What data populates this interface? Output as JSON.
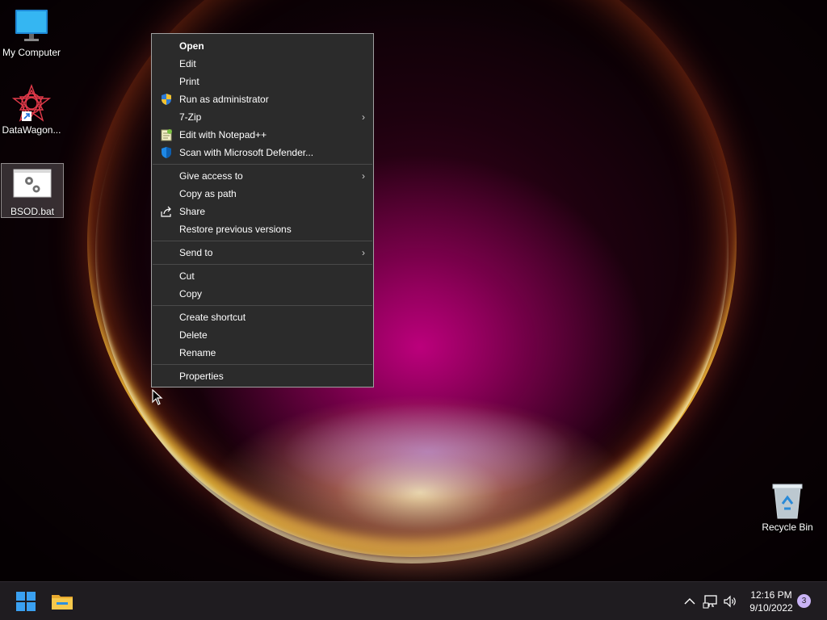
{
  "desktop_icons": [
    {
      "label": "My Computer",
      "icon": "monitor-icon"
    },
    {
      "label": "DataWagon...",
      "icon": "datawagon-shortcut-icon"
    },
    {
      "label": "BSOD.bat",
      "icon": "batch-file-icon",
      "selected": true
    },
    {
      "label": "Recycle Bin",
      "icon": "recycle-bin-icon"
    }
  ],
  "context_menu": {
    "groups": [
      [
        {
          "label": "Open",
          "bold": true
        },
        {
          "label": "Edit"
        },
        {
          "label": "Print"
        },
        {
          "label": "Run as administrator",
          "icon": "uac-shield-icon"
        },
        {
          "label": "7-Zip",
          "submenu": true
        },
        {
          "label": "Edit with Notepad++",
          "icon": "notepad-plus-plus-icon"
        },
        {
          "label": "Scan with Microsoft Defender...",
          "icon": "defender-shield-icon"
        }
      ],
      [
        {
          "label": "Give access to",
          "submenu": true
        },
        {
          "label": "Copy as path"
        },
        {
          "label": "Share",
          "icon": "share-icon"
        },
        {
          "label": "Restore previous versions"
        }
      ],
      [
        {
          "label": "Send to",
          "submenu": true
        }
      ],
      [
        {
          "label": "Cut"
        },
        {
          "label": "Copy"
        }
      ],
      [
        {
          "label": "Create shortcut"
        },
        {
          "label": "Delete"
        },
        {
          "label": "Rename"
        }
      ],
      [
        {
          "label": "Properties"
        }
      ]
    ],
    "submenu_glyph": "›"
  },
  "taskbar": {
    "pinned": [
      {
        "name": "start-button",
        "icon": "windows-logo-icon"
      },
      {
        "name": "file-explorer-button",
        "icon": "folder-icon"
      }
    ],
    "tray": {
      "overflow_glyph": "^",
      "time": "12:16 PM",
      "date": "9/10/2022",
      "notification_count": "3"
    }
  },
  "colors": {
    "menu_bg": "#2b2b2b",
    "menu_border": "#a0a0a0",
    "taskbar_bg": "#1f1c20",
    "windows_blue": "#3aa0f0",
    "folder_yellow": "#f2c14a",
    "badge": "#c9b3f5"
  }
}
